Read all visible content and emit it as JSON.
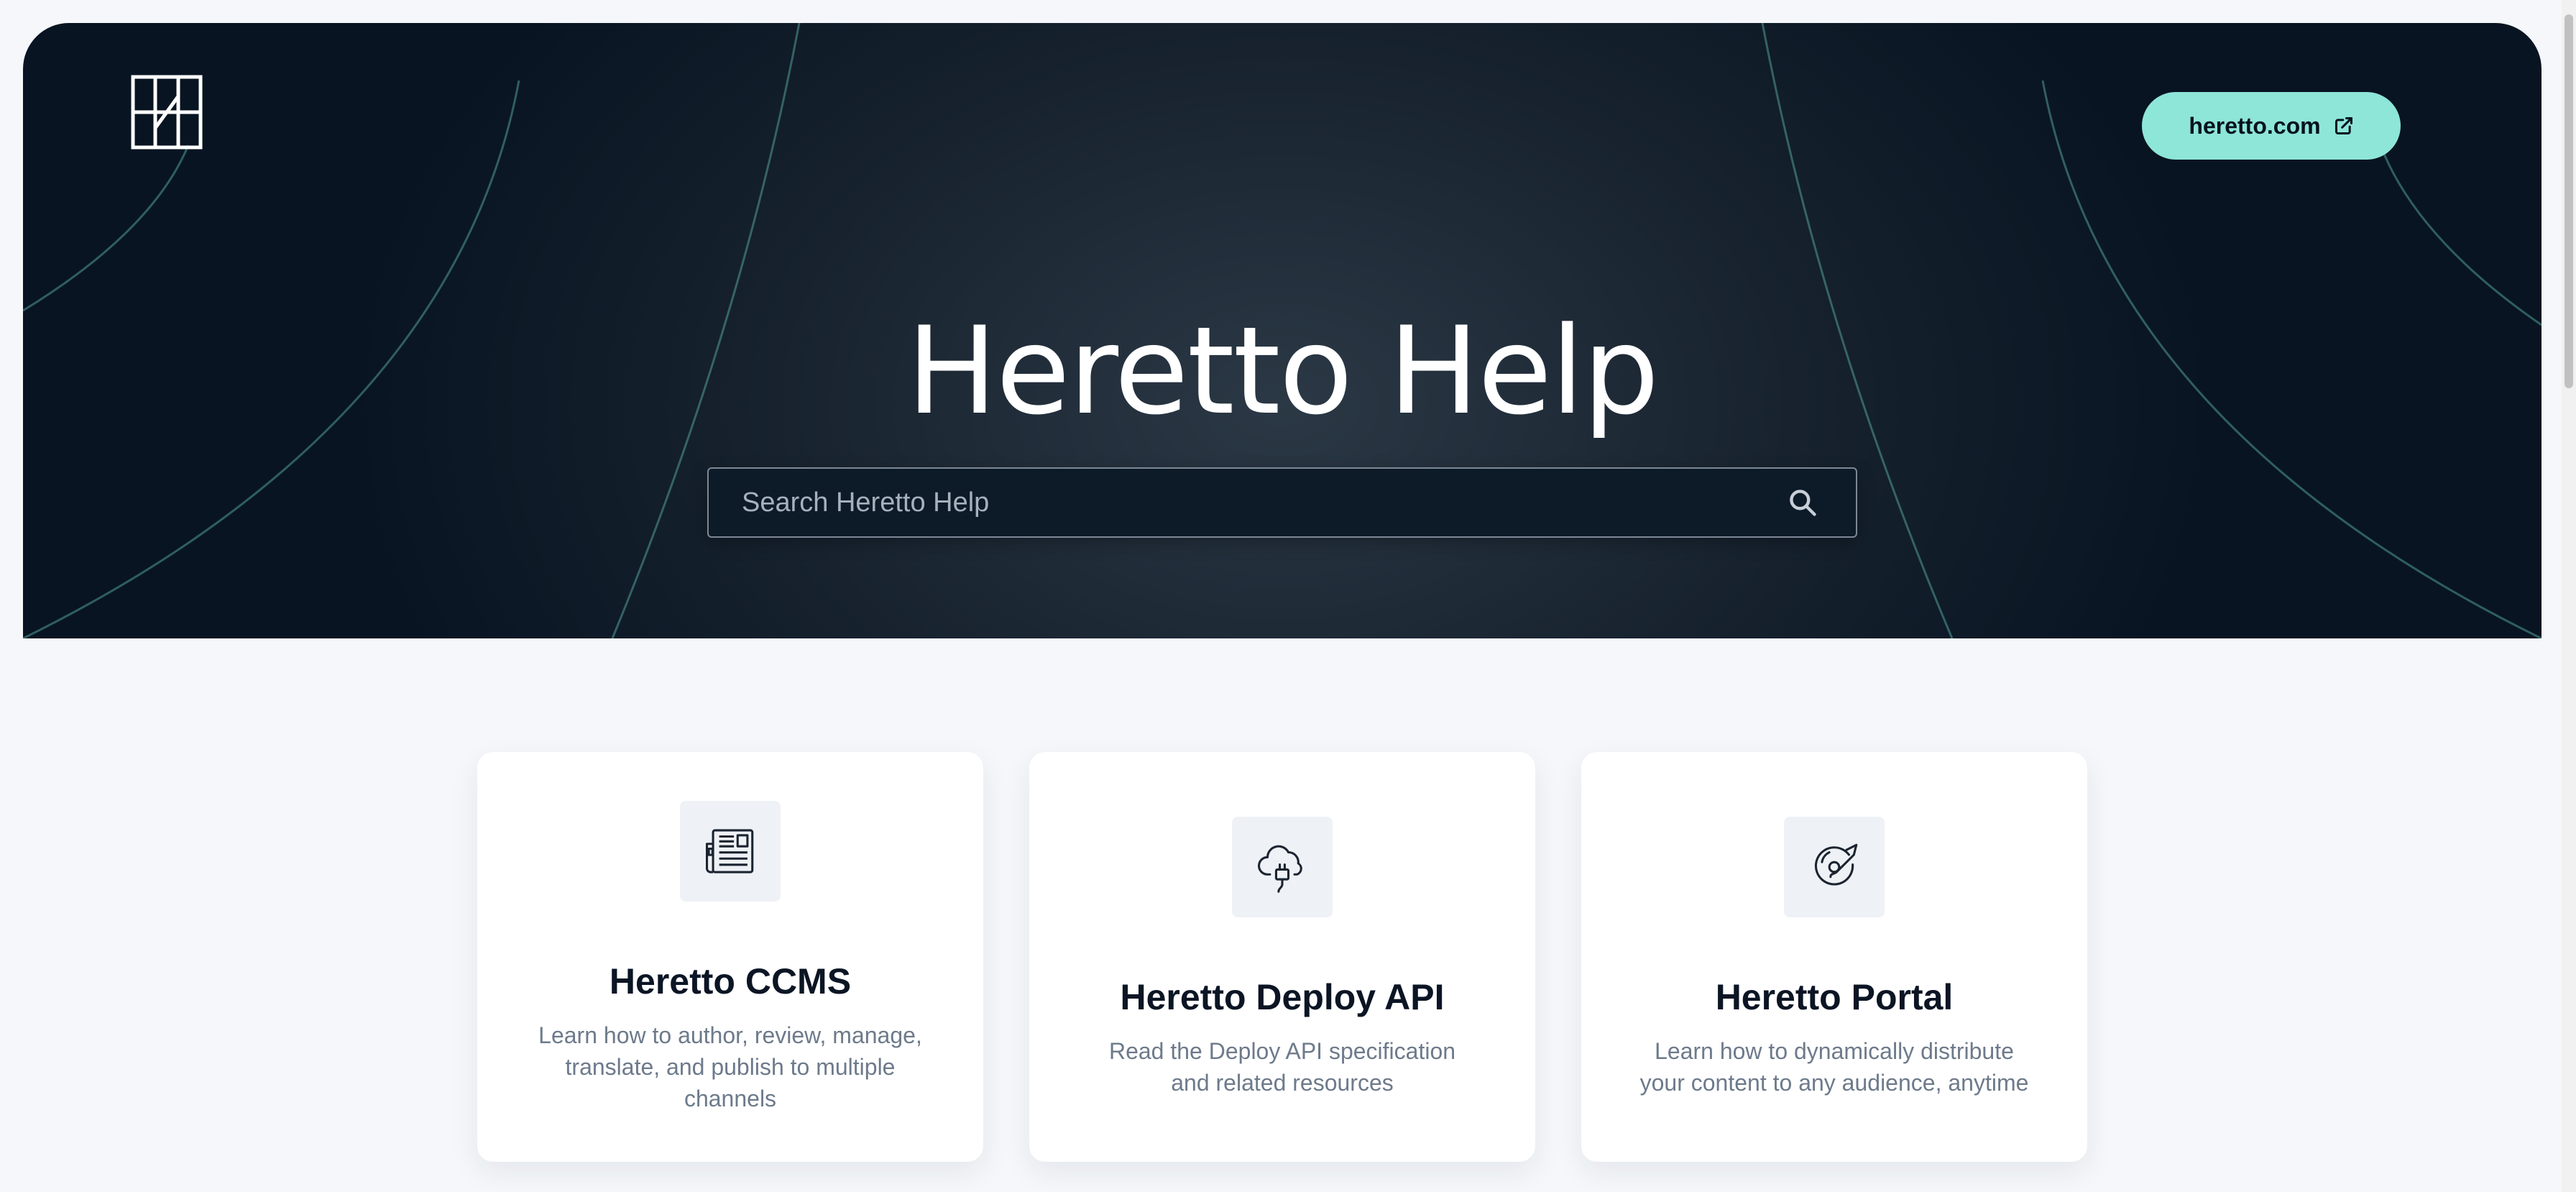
{
  "header": {
    "logo_icon": "heretto-logo-icon",
    "site_link_label": "heretto.com",
    "site_link_icon": "external-link-icon",
    "accent_color": "#8ee6d8"
  },
  "hero": {
    "title": "Heretto Help"
  },
  "search": {
    "placeholder": "Search Heretto Help",
    "icon": "search-icon"
  },
  "cards": [
    {
      "icon": "newspaper-icon",
      "title": "Heretto CCMS",
      "description": "Learn how to author, review, manage, translate, and publish to multiple channels"
    },
    {
      "icon": "cloud-plug-icon",
      "title": "Heretto Deploy API",
      "description": "Read the Deploy API specification and related resources"
    },
    {
      "icon": "disc-brush-icon",
      "title": "Heretto Portal",
      "description": "Learn how to dynamically distribute your content to any audience, anytime"
    }
  ]
}
